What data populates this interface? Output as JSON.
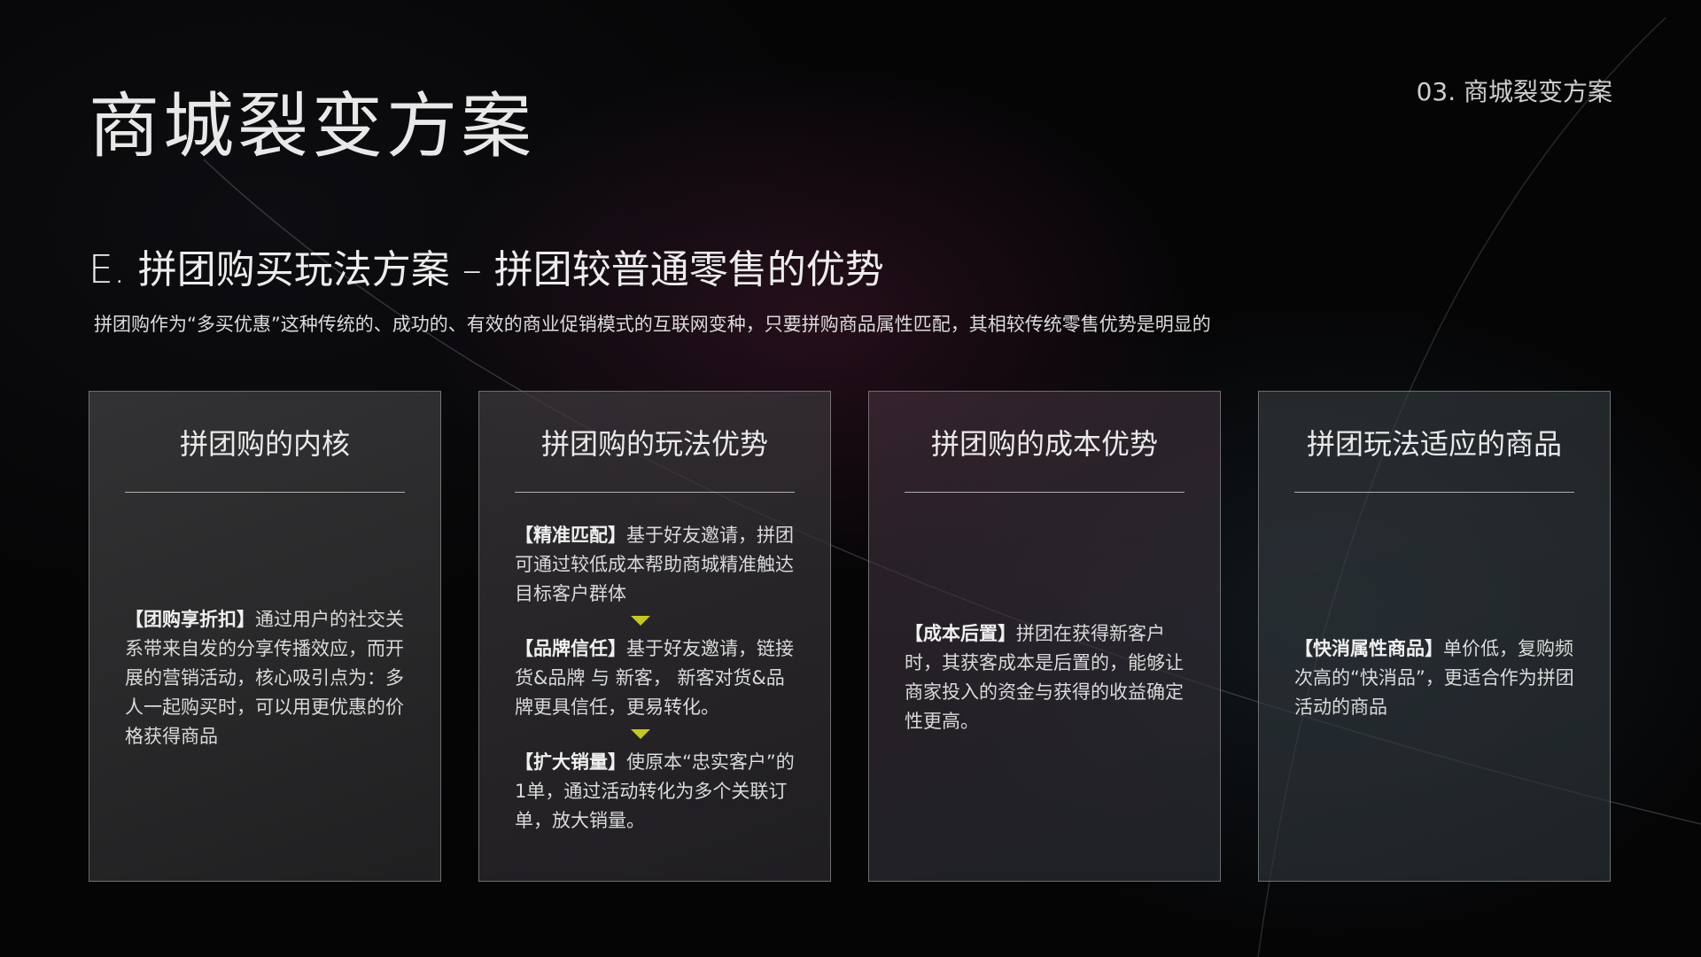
{
  "header": {
    "title": "商城裂变方案",
    "section_label": "03. 商城裂变方案"
  },
  "content": {
    "subtitle": "E. 拼团购买玩法方案 – 拼团较普通零售的优势",
    "intro": "拼团购作为“多买优惠”这种传统的、成功的、有效的商业促销模式的互联网变种，只要拼购商品属性匹配，其相较传统零售优势是明显的"
  },
  "cards": [
    {
      "title": "拼团购的内核",
      "paragraphs": [
        {
          "tag": "【团购享折扣】",
          "text": "通过用户的社交关系带来自发的分享传播效应，而开展的营销活动，核心吸引点为：多人一起购买时，可以用更优惠的价格获得商品"
        }
      ]
    },
    {
      "title": "拼团购的玩法优势",
      "paragraphs": [
        {
          "tag": "【精准匹配】",
          "text": "基于好友邀请，拼团可通过较低成本帮助商城精准触达目标客户群体"
        },
        {
          "tag": "【品牌信任】",
          "text": "基于好友邀请，链接货&品牌 与 新客， 新客对货&品牌更具信任，更易转化。"
        },
        {
          "tag": "【扩大销量】",
          "text": "使原本“忠实客户”的1单，通过活动转化为多个关联订单，放大销量。"
        }
      ]
    },
    {
      "title": "拼团购的成本优势",
      "paragraphs": [
        {
          "tag": "【成本后置】",
          "text": "拼团在获得新客户时，其获客成本是后置的，能够让商家投入的资金与获得的收益确定性更高。"
        }
      ]
    },
    {
      "title": "拼团玩法适应的商品",
      "paragraphs": [
        {
          "tag": "【快消属性商品】",
          "text": "单价低，复购频次高的“快消品”，更适合作为拼团活动的商品"
        }
      ]
    }
  ],
  "colors": {
    "background": "#050506",
    "arrow_accent": "#c8c81c",
    "text": "#e6e6e6"
  }
}
